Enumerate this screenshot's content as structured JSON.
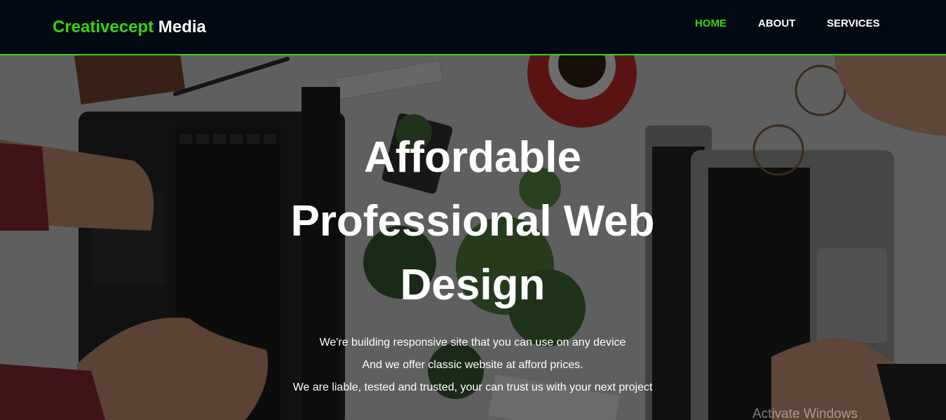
{
  "brand": {
    "part1": "Creativecept",
    "part2": "Media"
  },
  "nav": {
    "items": [
      {
        "label": "HOME",
        "active": true
      },
      {
        "label": "ABOUT",
        "active": false
      },
      {
        "label": "SERVICES",
        "active": false
      }
    ]
  },
  "hero": {
    "title_lines": [
      "Affordable",
      "Professional Web",
      "Design"
    ],
    "lines": [
      "We're building responsive site that you can use on any device",
      "And we offer classic website at afford prices.",
      "We are liable, tested and trusted, your can trust us with your next project"
    ]
  },
  "watermark": "Activate Windows",
  "colors": {
    "accent": "#39d40f",
    "nav_bg": "#010a12",
    "text": "#ffffff"
  }
}
